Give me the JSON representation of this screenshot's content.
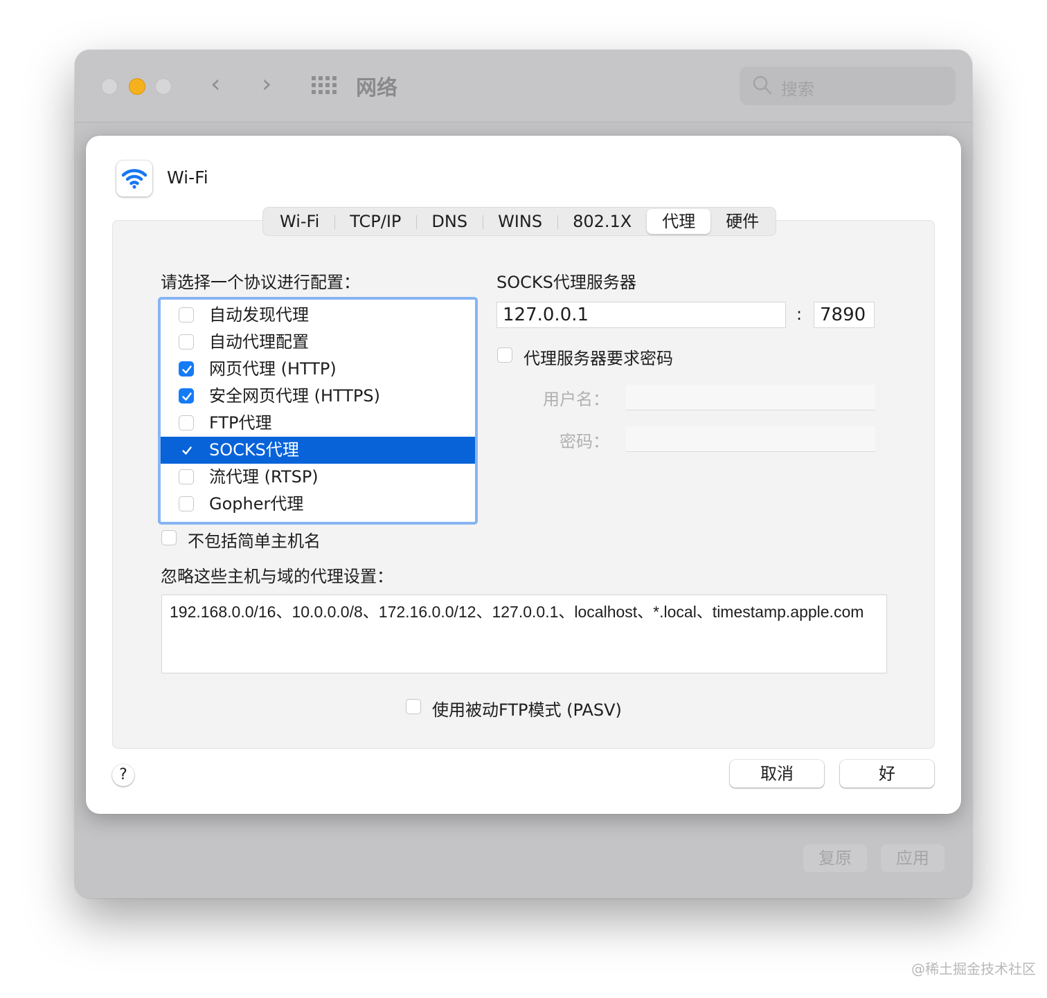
{
  "window": {
    "title": "网络",
    "search_placeholder": "搜索",
    "back_icon": "chevron-left-icon",
    "forward_icon": "chevron-right-icon",
    "revert_label": "复原",
    "apply_label": "应用"
  },
  "sheet": {
    "interface_name": "Wi-Fi",
    "tabs": [
      {
        "label": "Wi-Fi",
        "active": false
      },
      {
        "label": "TCP/IP",
        "active": false
      },
      {
        "label": "DNS",
        "active": false
      },
      {
        "label": "WINS",
        "active": false
      },
      {
        "label": "802.1X",
        "active": false
      },
      {
        "label": "代理",
        "active": true
      },
      {
        "label": "硬件",
        "active": false
      }
    ],
    "protocols_label": "请选择一个协议进行配置：",
    "protocols": [
      {
        "label": "自动发现代理",
        "checked": false,
        "selected": false
      },
      {
        "label": "自动代理配置",
        "checked": false,
        "selected": false
      },
      {
        "label": "网页代理 (HTTP)",
        "checked": true,
        "selected": false
      },
      {
        "label": "安全网页代理 (HTTPS)",
        "checked": true,
        "selected": false
      },
      {
        "label": "FTP代理",
        "checked": false,
        "selected": false
      },
      {
        "label": "SOCKS代理",
        "checked": true,
        "selected": true
      },
      {
        "label": "流代理 (RTSP)",
        "checked": false,
        "selected": false
      },
      {
        "label": "Gopher代理",
        "checked": false,
        "selected": false
      }
    ],
    "server_label": "SOCKS代理服务器",
    "server_address": "127.0.0.1",
    "server_colon": ":",
    "server_port": "7890",
    "requires_password_label": "代理服务器要求密码",
    "username_label": "用户名：",
    "password_label": "密码：",
    "exclude_simple_label": "不包括简单主机名",
    "bypass_label": "忽略这些主机与域的代理设置：",
    "bypass_value": "192.168.0.0/16、10.0.0.0/8、172.16.0.0/12、127.0.0.1、localhost、*.local、timestamp.apple.com",
    "pasv_label": "使用被动FTP模式 (PASV)",
    "help_label": "?",
    "cancel_label": "取消",
    "ok_label": "好"
  },
  "watermark": "@稀土掘金技术社区",
  "colors": {
    "accent": "#157bf5",
    "selection": "#0863d9",
    "focus_ring": "#86b4f3",
    "minimize": "#f5b11d"
  }
}
